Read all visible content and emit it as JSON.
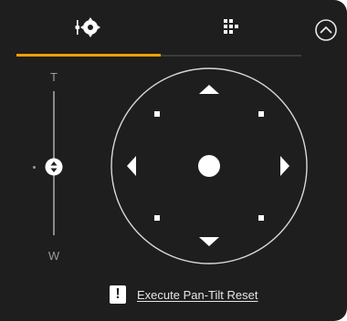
{
  "tabs": [
    {
      "icon": "pan-tilt-icon",
      "active": true
    },
    {
      "icon": "preset-grid-icon",
      "active": false
    }
  ],
  "collapse_icon": "chevron-up-circle-icon",
  "zoom": {
    "tele_label": "T",
    "wide_label": "W"
  },
  "pad_icons": [
    "arrow-up-icon",
    "arrow-down-icon",
    "arrow-left-icon",
    "arrow-right-icon",
    "center-icon",
    "diagonal-up-left-icon",
    "diagonal-up-right-icon",
    "diagonal-down-left-icon",
    "diagonal-down-right-icon"
  ],
  "reset": {
    "icon_text": "!",
    "label": "Execute Pan-Tilt Reset"
  },
  "colors": {
    "background": "#1e1e1e",
    "accent": "#f0a000",
    "icon": "#ffffff",
    "muted": "#9a9a9a"
  }
}
